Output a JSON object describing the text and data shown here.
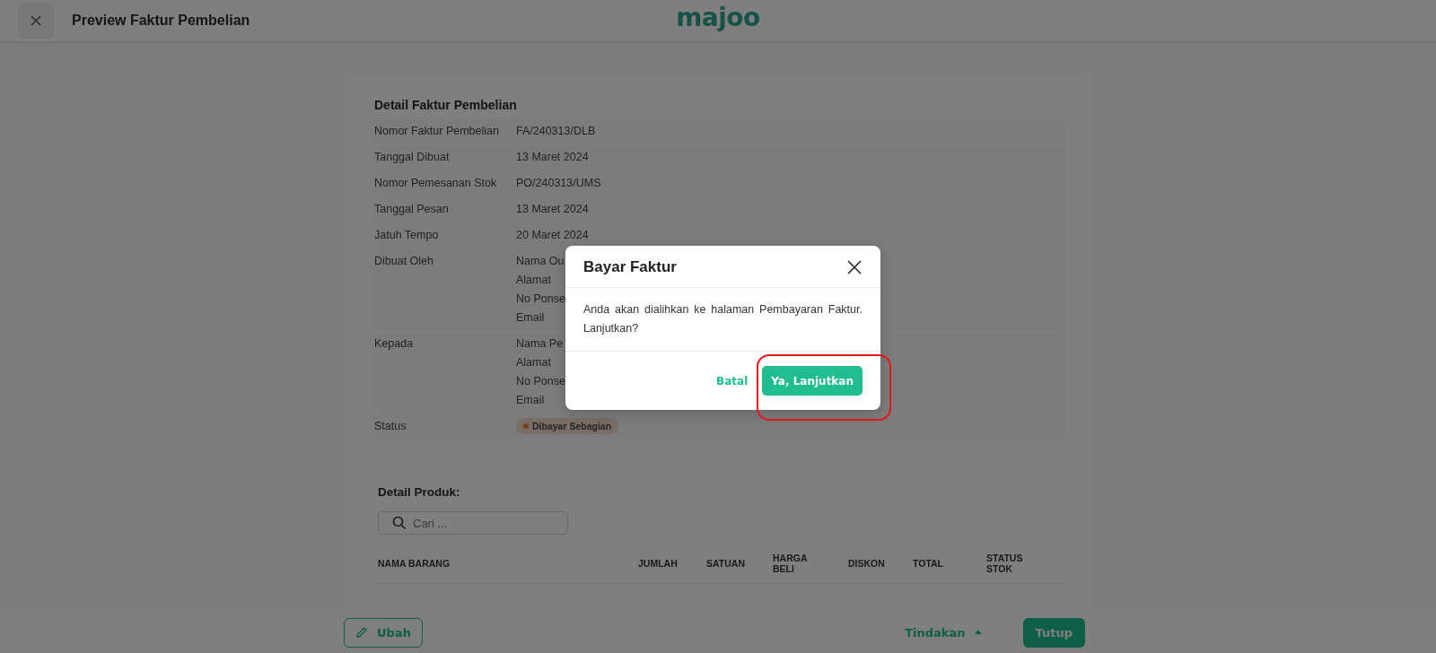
{
  "header": {
    "title": "Preview Faktur Pembelian",
    "logo": "majoo"
  },
  "detail": {
    "title": "Detail Faktur Pembelian",
    "rows": [
      {
        "label": "Nomor Faktur Pembelian",
        "values": [
          "FA/240313/DLB"
        ]
      },
      {
        "label": "Tanggal Dibuat",
        "values": [
          "13 Maret 2024"
        ]
      },
      {
        "label": "Nomor Pemesanan Stok",
        "values": [
          "PO/240313/UMS"
        ]
      },
      {
        "label": "Tanggal Pesan",
        "values": [
          "13 Maret 2024"
        ]
      },
      {
        "label": "Jatuh Tempo",
        "values": [
          "20 Maret 2024"
        ]
      },
      {
        "label": "Dibuat Oleh",
        "values": [
          "Nama Ou",
          "Alamat",
          "No Ponse",
          "Email"
        ]
      },
      {
        "label": "Kepada",
        "values": [
          "Nama Pe",
          "Alamat",
          "No Ponse",
          "Email"
        ]
      }
    ],
    "status": {
      "label": "Status",
      "badge": "Dibayar Sebagian",
      "color": "#773d1d"
    }
  },
  "products": {
    "title": "Detail Produk:",
    "search": {
      "placeholder": "Cari ..."
    },
    "columns": [
      "NAMA BARANG",
      "JUMLAH",
      "SATUAN",
      "HARGA BELI",
      "DISKON",
      "TOTAL",
      "STATUS STOK"
    ]
  },
  "footer": {
    "edit_button": "Ubah",
    "actions": "Tindakan",
    "close_button": "Tutup"
  },
  "dialog": {
    "title": "Bayar Faktur",
    "message": "Anda akan dialihkan ke halaman Pembayaran Faktur. Lanjutkan?",
    "cancel": "Batal",
    "confirm": "Ya, Lanjutkan",
    "confirm_highlighted": true
  }
}
